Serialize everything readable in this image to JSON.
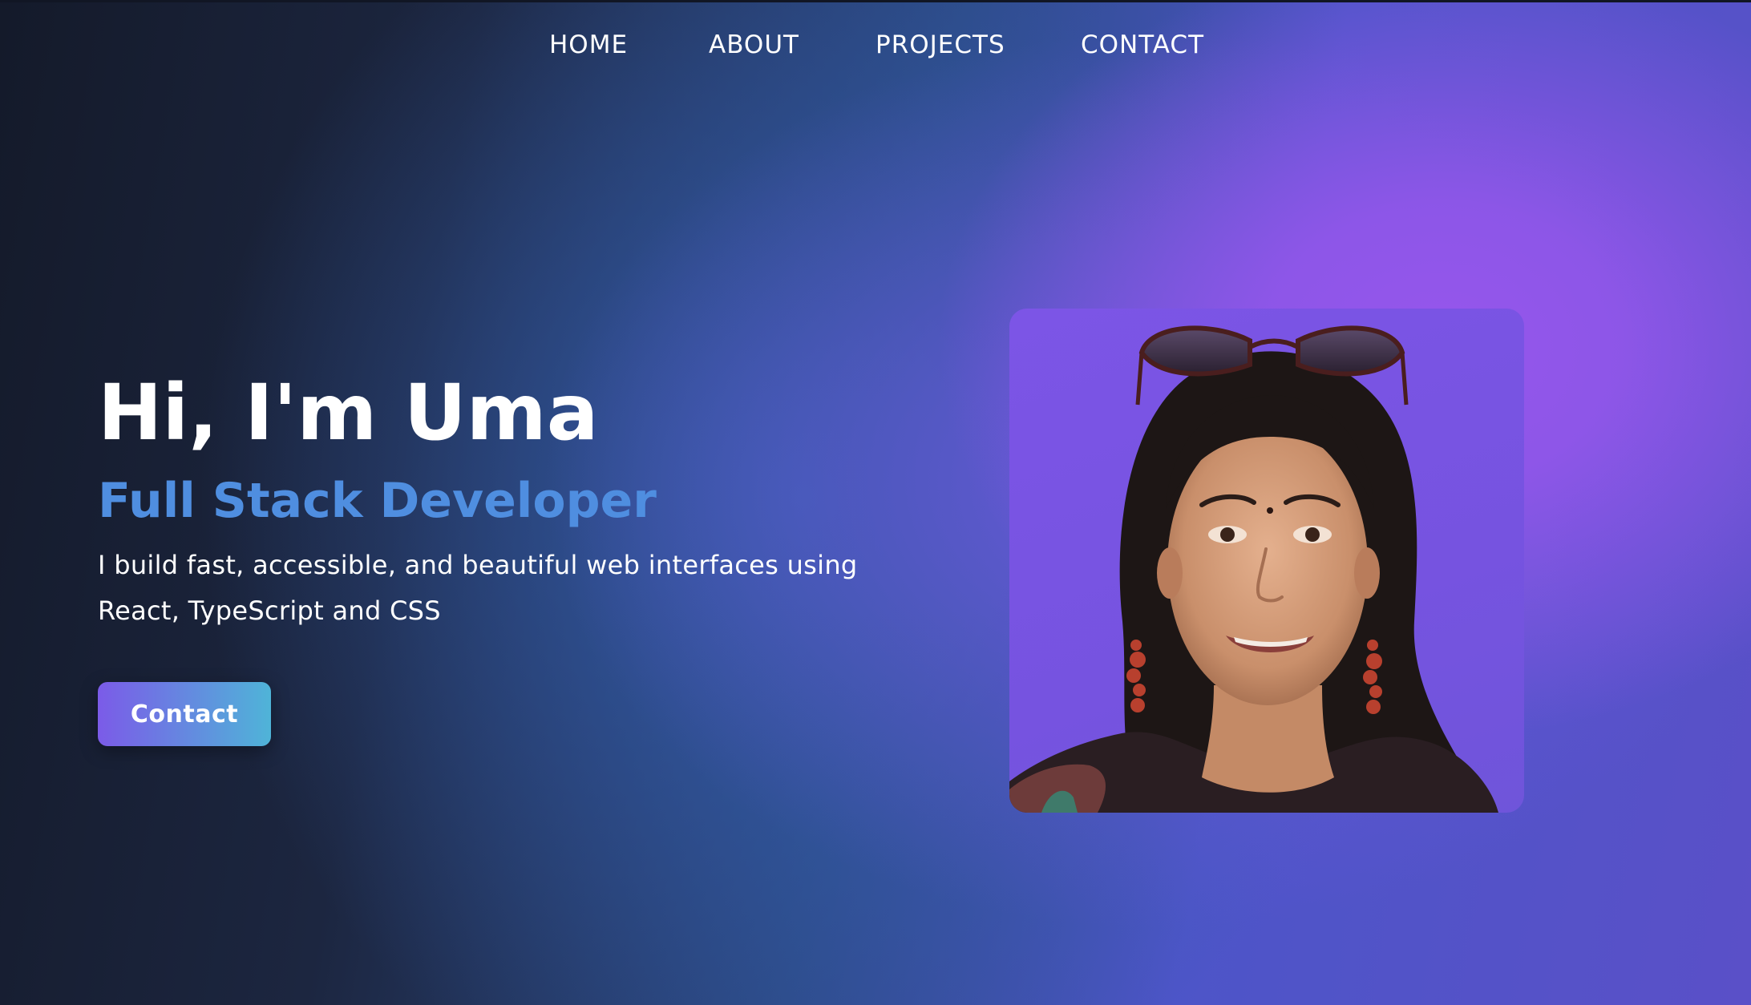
{
  "nav": {
    "items": [
      {
        "label": "HOME"
      },
      {
        "label": "ABOUT"
      },
      {
        "label": "PROJECTS"
      },
      {
        "label": "CONTACT"
      }
    ]
  },
  "hero": {
    "title": "Hi, I'm Uma",
    "subtitle": "Full Stack Developer",
    "description": "I build fast, accessible, and beautiful web interfaces using React, TypeScript and CSS",
    "cta_label": "Contact"
  },
  "colors": {
    "accent_text": "#4f8ee0",
    "button_gradient_start": "#7b5be8",
    "button_gradient_end": "#4fb4d8",
    "background_glow": "#9656ec"
  }
}
